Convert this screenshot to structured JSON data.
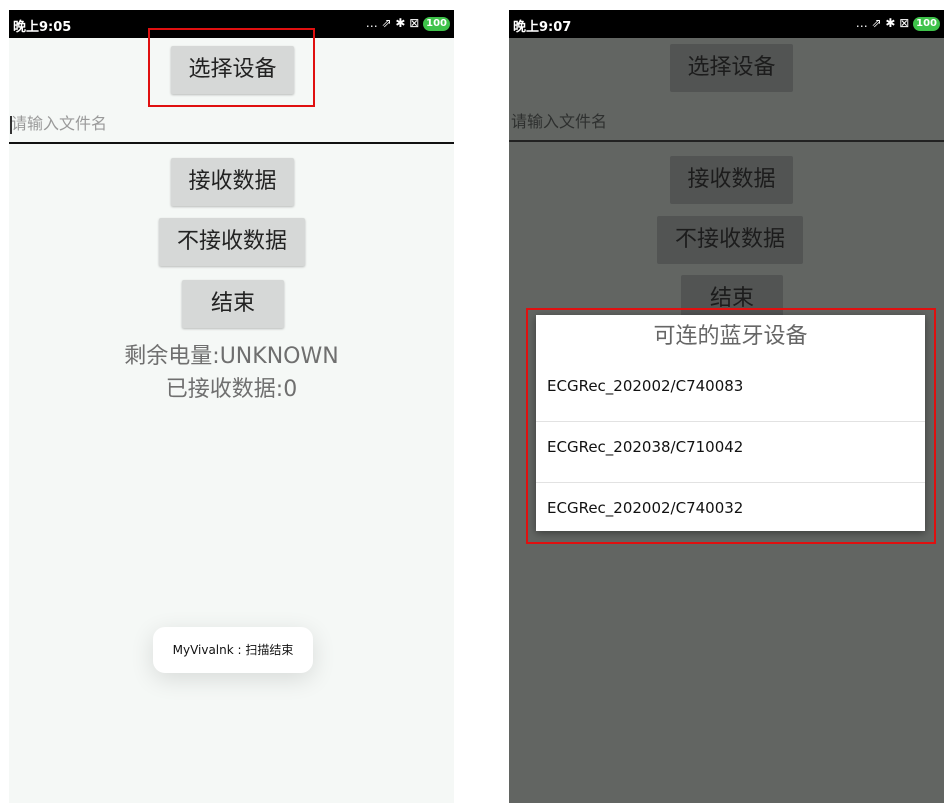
{
  "left": {
    "status_time": "晚上9:05",
    "status_icons": "… ⇗ ✱ ⊠",
    "battery": "100",
    "select_device": "选择设备",
    "filename_placeholder": "请输入文件名",
    "receive_data": "接收数据",
    "stop_receive": "不接收数据",
    "end": "结束",
    "battery_remaining": "剩余电量:UNKNOWN",
    "received_data": "已接收数据:0",
    "toast": "MyVivalnk : 扫描结束"
  },
  "right": {
    "status_time": "晚上9:07",
    "status_icons": "… ⇗ ✱ ⊠",
    "battery": "100",
    "select_device": "选择设备",
    "filename_placeholder": "请输入文件名",
    "receive_data": "接收数据",
    "stop_receive": "不接收数据",
    "end": "结束",
    "dialog": {
      "title": "可连的蓝牙设备",
      "devices": [
        "ECGRec_202002/C740083",
        "ECGRec_202038/C710042",
        "ECGRec_202002/C740032"
      ]
    }
  },
  "highlight_color": "#e01010"
}
